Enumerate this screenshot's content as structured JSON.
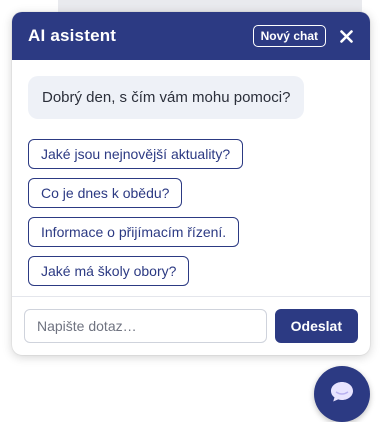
{
  "colors": {
    "brand": "#2c3a83",
    "bubble_bg": "#eef1f7",
    "fab_icon": "#e8e4ff"
  },
  "header": {
    "title": "AI asistent",
    "new_chat_label": "Nový chat",
    "close_icon": "close-icon"
  },
  "messages": {
    "bot_greeting": "Dobrý den, s čím vám mohu pomoci?"
  },
  "suggestions": [
    {
      "label": "Jaké jsou nejnovější aktuality?"
    },
    {
      "label": "Co je dnes k obědu?"
    },
    {
      "label": "Informace o přijímacím řízení."
    },
    {
      "label": "Jaké má školy obory?"
    }
  ],
  "input": {
    "placeholder": "Napište dotaz…",
    "value": "",
    "send_label": "Odeslat"
  },
  "fab": {
    "icon": "chat-bubble-icon"
  }
}
